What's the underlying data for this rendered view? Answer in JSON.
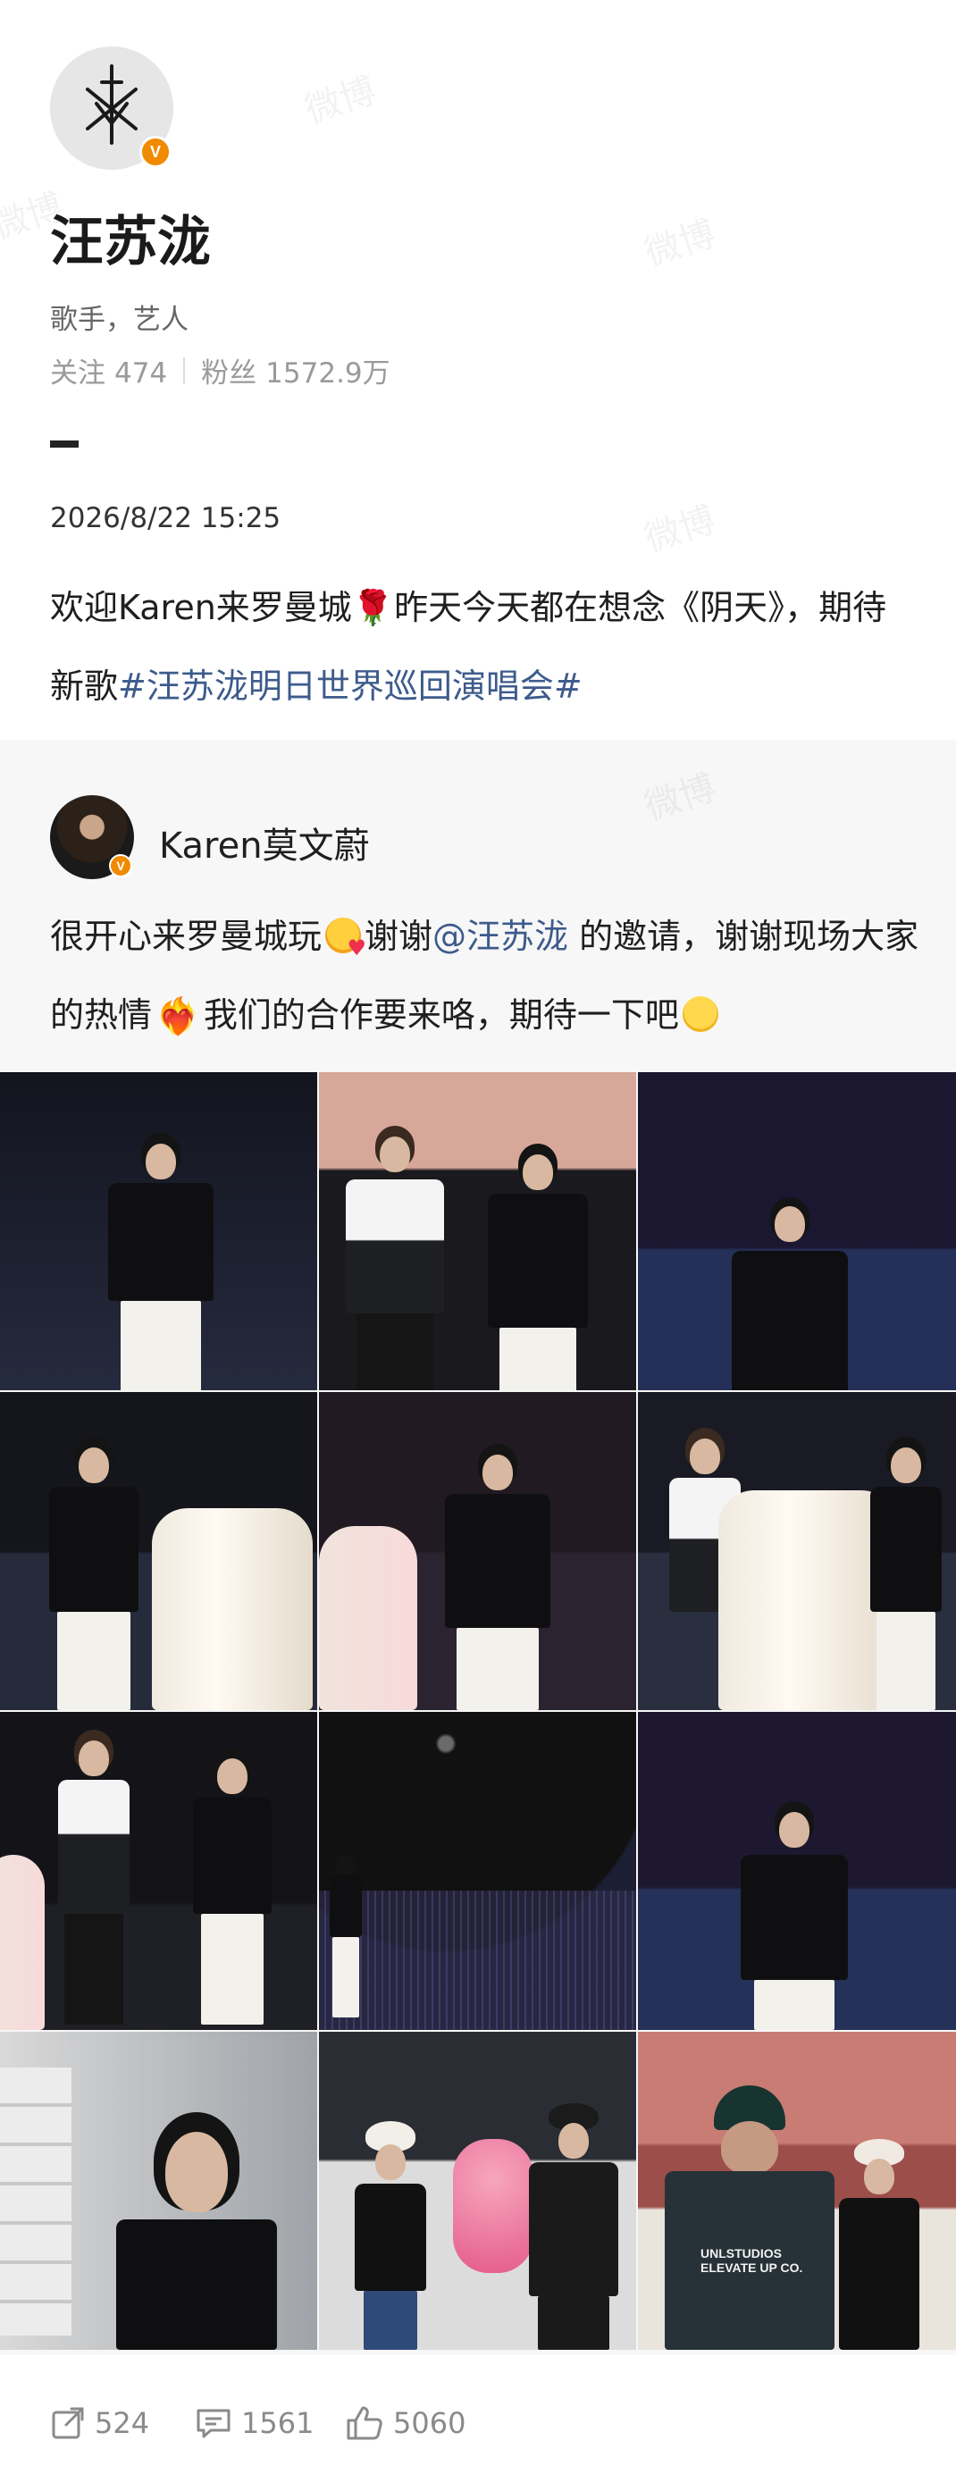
{
  "profile": {
    "name": "汪苏泷",
    "bio": "歌手，艺人",
    "following_label": "关注",
    "following_count": "474",
    "followers_label": "粉丝",
    "followers_count": "1572.9万",
    "verified_badge": "V"
  },
  "post": {
    "timestamp": "2026/8/22 15:25",
    "text_before_rose": "欢迎Karen来罗曼城",
    "rose_emoji": "🌹",
    "text_after_rose": "昨天今天都在想念《阴天》，期待新歌",
    "hashtag": "#汪苏泷明日世界巡回演唱会#"
  },
  "repost": {
    "author": "Karen莫文蔚",
    "text_part1": "很开心来罗曼城玩",
    "text_part2": "谢谢",
    "mention": "@汪苏泷",
    "text_part3": " 的邀请，谢谢现场大家的热情",
    "text_part4": "我们的合作要来咯，期待一下吧",
    "emoji_heart": "❤‍🔥",
    "photos": [
      "photo-1-karen-pointing",
      "photo-2-duo-on-stage",
      "photo-3-karen-waving",
      "photo-4-duo-with-piano",
      "photo-5-karen-waving-by-piano",
      "photo-6-duo-with-piano",
      "photo-7-duo-talking",
      "photo-8-stadium-wide",
      "photo-9-karen-singing-waving",
      "photo-10-karen-portrait",
      "photo-11-rehearsal-gift",
      "photo-12-rehearsal-backstage"
    ],
    "photo_cap_text": "UNLSTUDIOS ELEVATE UP CO."
  },
  "footer": {
    "share_count": "524",
    "comment_count": "1561",
    "like_count": "5060"
  },
  "watermark": "微博",
  "colors": {
    "link": "#3d5b8c",
    "badge": "#f08a00",
    "muted": "#9a9a9a"
  }
}
